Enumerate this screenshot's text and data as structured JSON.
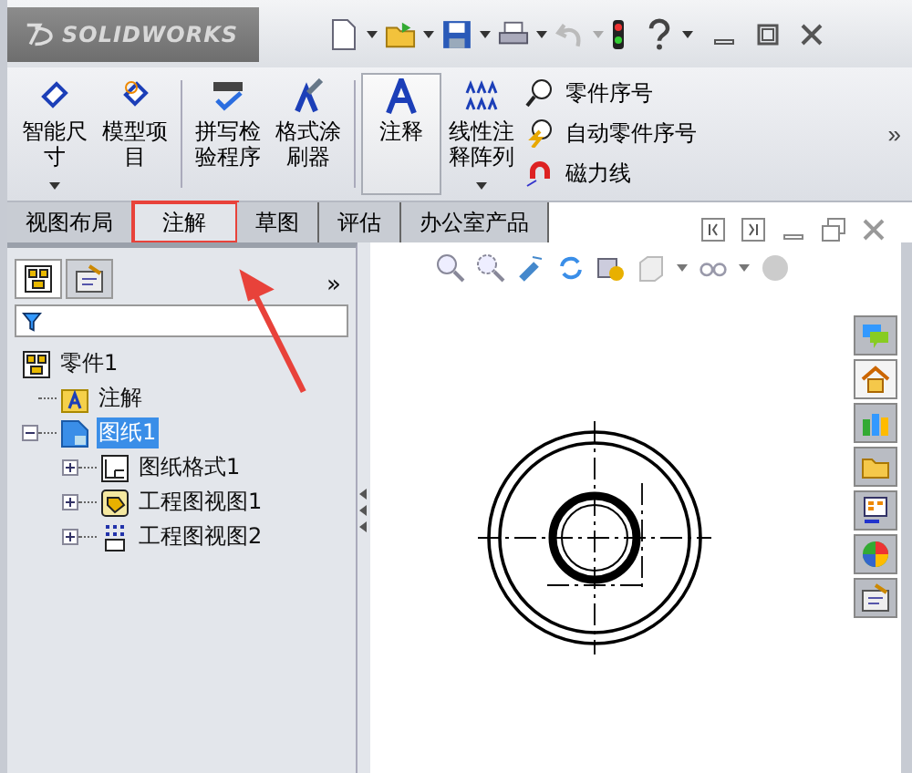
{
  "title_bar": {
    "logo": "SOLIDWORKS"
  },
  "ribbon": {
    "groups": [
      {
        "buttons": [
          {
            "label": "智能尺寸",
            "kind": "dimension",
            "dropdown": true,
            "selected": false
          },
          {
            "label": "模型项目",
            "kind": "model-items",
            "dropdown": false,
            "selected": false
          }
        ]
      },
      {
        "buttons": [
          {
            "label": "拼写检验程序",
            "kind": "spell",
            "dropdown": false,
            "selected": false
          },
          {
            "label": "格式涂刷器",
            "kind": "painter",
            "dropdown": false,
            "selected": false
          }
        ]
      },
      {
        "buttons": [
          {
            "label": "注释",
            "kind": "note",
            "dropdown": false,
            "selected": true
          },
          {
            "label": "线性注释阵列",
            "kind": "pattern",
            "dropdown": true,
            "selected": false
          }
        ]
      }
    ],
    "small_buttons": [
      {
        "label": "零件序号",
        "kind": "balloon"
      },
      {
        "label": "自动零件序号",
        "kind": "auto-balloon"
      },
      {
        "label": "磁力线",
        "kind": "magnet"
      }
    ],
    "more": "»"
  },
  "tabs": [
    {
      "label": "视图布局",
      "selected": false,
      "highlighted": false
    },
    {
      "label": "注解",
      "selected": true,
      "highlighted": true
    },
    {
      "label": "草图",
      "selected": false,
      "highlighted": false
    },
    {
      "label": "评估",
      "selected": false,
      "highlighted": false
    },
    {
      "label": "办公室产品",
      "selected": false,
      "highlighted": false
    }
  ],
  "feature_manager": {
    "panel_tabs": [
      {
        "kind": "tree",
        "selected": true
      },
      {
        "kind": "properties",
        "selected": false
      }
    ],
    "more": "»",
    "tree": [
      {
        "label": "零件1",
        "kind": "part",
        "selected": false,
        "children": [
          {
            "label": "注解",
            "kind": "annotations",
            "selected": false
          },
          {
            "label": "图纸1",
            "kind": "sheet",
            "selected": true,
            "expanded": true,
            "children": [
              {
                "label": "图纸格式1",
                "kind": "sheet-format",
                "selected": false,
                "expanded": false
              },
              {
                "label": "工程图视图1",
                "kind": "view",
                "selected": false,
                "expanded": false
              },
              {
                "label": "工程图视图2",
                "kind": "view2",
                "selected": false,
                "expanded": false
              }
            ]
          }
        ]
      }
    ]
  }
}
